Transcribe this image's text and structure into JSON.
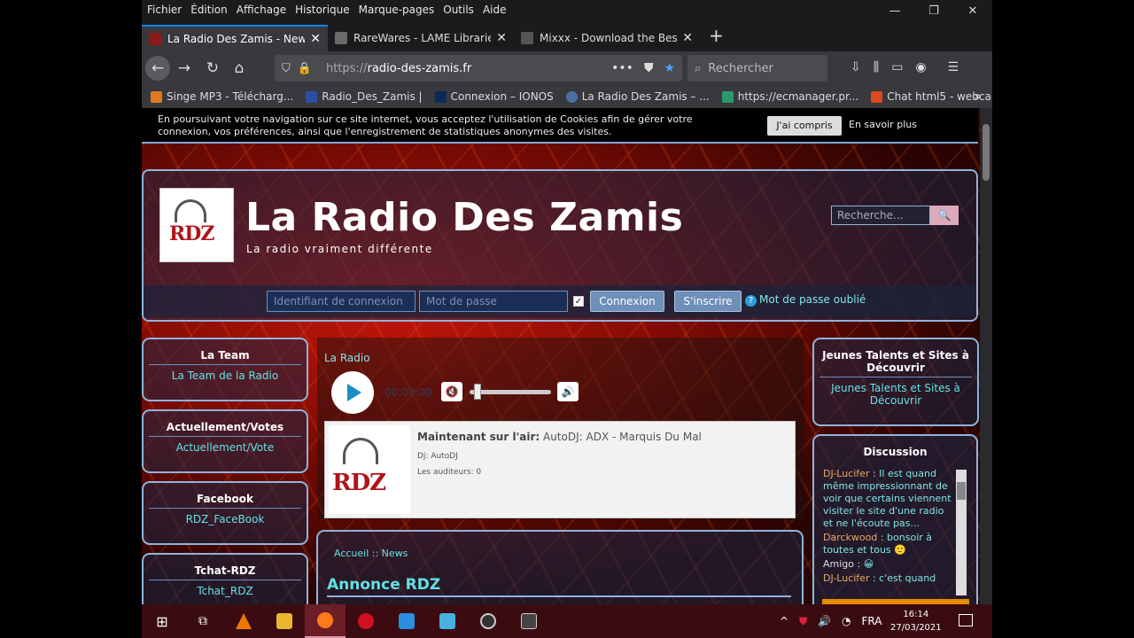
{
  "menubar": {
    "items": [
      "Fichier",
      "Édition",
      "Affichage",
      "Historique",
      "Marque-pages",
      "Outils",
      "Aide"
    ]
  },
  "window_controls": {
    "minimize": "—",
    "restore": "❐",
    "close": "✕"
  },
  "tabs": [
    {
      "title": "La Radio Des Zamis - News",
      "active": true,
      "favcolor": "#8b1a1a"
    },
    {
      "title": "RareWares - LAME Libraries",
      "active": false,
      "favcolor": "#6a6a6a"
    },
    {
      "title": "Mixxx - Download the Best Free DJ",
      "active": false,
      "favcolor": "#555"
    }
  ],
  "tab_close": "✕",
  "new_tab": "+",
  "navbar": {
    "url_prefix": "https://",
    "url_host": "radio-des-zamis.fr",
    "search_placeholder": "Rechercher",
    "back": "←",
    "forward": "→",
    "reload": "↻",
    "home": "⌂"
  },
  "bookmarks": [
    {
      "label": "Singe MP3 - Télécharg...",
      "color": "#e07a20"
    },
    {
      "label": "Radio_Des_Zamis |",
      "color": "#2a4fa0"
    },
    {
      "label": "Connexion – IONOS",
      "color": "#0b2a5a"
    },
    {
      "label": "La Radio Des Zamis – ...",
      "color": "#4a6fa0"
    },
    {
      "label": "https://ecmanager.pr...",
      "color": "#2a9a6a"
    },
    {
      "label": "Chat html5 - webcam ...",
      "color": "#e04a20"
    }
  ],
  "bookmarks_more": "»",
  "cookie": {
    "text": "En poursuivant votre navigation sur ce site internet, vous acceptez l'utilisation de Cookies afin de gérer votre connexion, vos préférences, ainsi que l'enregistrement de statistiques anonymes des visites.",
    "accept": "J'ai compris",
    "more": "En savoir plus"
  },
  "site": {
    "title": "La Radio Des Zamis",
    "subtitle": "La radio vraiment différente",
    "logo_text": "RDZ",
    "search_placeholder": "Recherche...",
    "search_button": "🔍"
  },
  "login": {
    "user_placeholder": "Identifiant de connexion",
    "pass_placeholder": "Mot de passe",
    "remember": "✓",
    "connect": "Connexion",
    "register": "S'inscrire",
    "forgot": "Mot de passe oublié",
    "forgot_icon": "?"
  },
  "left_boxes": [
    {
      "heading": "La Team",
      "link": "La Team de la Radio"
    },
    {
      "heading": "Actuellement/Votes",
      "link": "Actuellement/Vote"
    },
    {
      "heading": "Facebook",
      "link": "RDZ_FaceBook"
    },
    {
      "heading": "Tchat-RDZ",
      "link": "Tchat_RDZ"
    }
  ],
  "radio": {
    "label": "La Radio",
    "time": "00:00:00",
    "mute_icon": "🔇",
    "vol_icon": "🔊",
    "volume": 0.1,
    "onair_label": "Maintenant sur l'air:",
    "onair_value": "AutoDJ: ADX - Marquis Du Mal",
    "dj": "Dj: AutoDJ",
    "listeners": "Les auditeurs: 0"
  },
  "news": {
    "breadcrumb": "Accueil :: News",
    "heading": "Annonce RDZ"
  },
  "right_box": {
    "heading": "Jeunes Talents et Sites à Découvrir",
    "link": "Jeunes Talents et Sites à Découvrir"
  },
  "discussion": {
    "heading": "Discussion",
    "messages": [
      {
        "user": "DJ-Lucifer",
        "text": " : Il est quand même impressionnant de voir que certains viennent visiter le site d'une radio et ne l'écoute pas..."
      },
      {
        "user": "Darckwood",
        "text": " : bonsoir à toutes et tous 🙂"
      },
      {
        "user": "Amigo",
        "text": " : 😀"
      },
      {
        "user": "DJ-Lucifer",
        "text": " : c'est quand"
      }
    ]
  },
  "taskbar": {
    "tray_up": "^",
    "lang": "FRA",
    "time": "16:14",
    "date": "27/03/2021"
  }
}
